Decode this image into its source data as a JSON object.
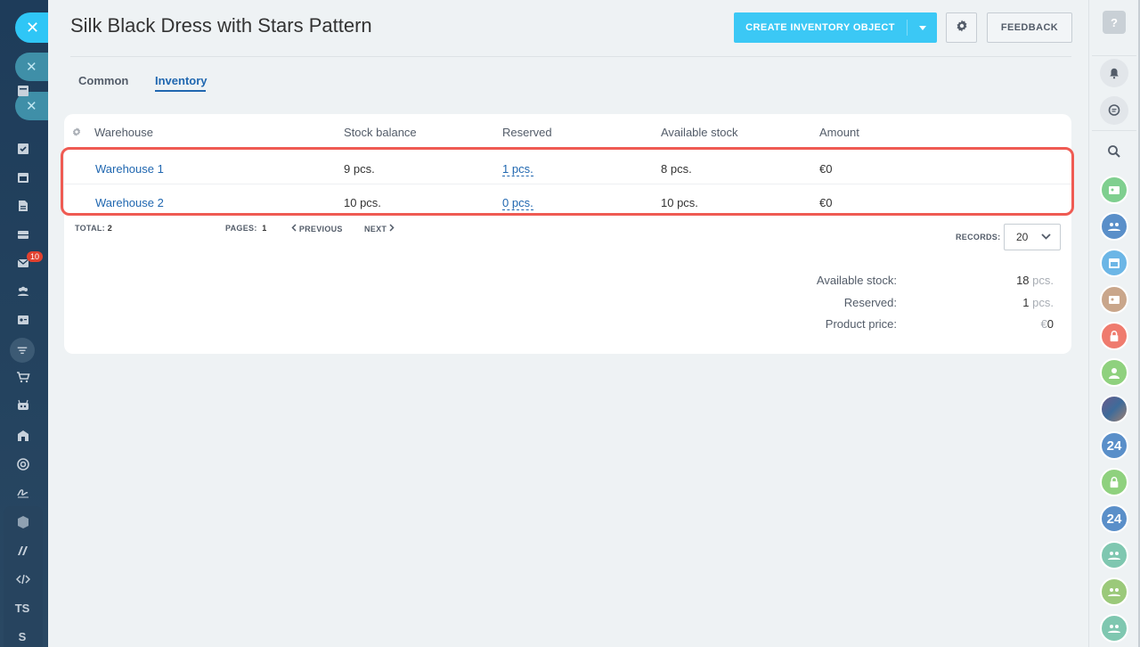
{
  "header": {
    "title": "Silk Black Dress with Stars Pattern",
    "create_button": "CREATE INVENTORY OBJECT",
    "feedback_button": "FEEDBACK"
  },
  "tabs": [
    {
      "label": "Common",
      "active": false
    },
    {
      "label": "Inventory",
      "active": true
    }
  ],
  "table": {
    "columns": [
      "Warehouse",
      "Stock balance",
      "Reserved",
      "Available stock",
      "Amount"
    ],
    "rows": [
      {
        "warehouse": "Warehouse 1",
        "stock_balance": "9 pcs.",
        "reserved": "1 pcs.",
        "available": "8 pcs.",
        "amount": "€0"
      },
      {
        "warehouse": "Warehouse 2",
        "stock_balance": "10 pcs.",
        "reserved": "0 pcs.",
        "available": "10 pcs.",
        "amount": "€0"
      }
    ]
  },
  "pager": {
    "total_label": "TOTAL:",
    "total_value": "2",
    "pages_label": "PAGES:",
    "pages_value": "1",
    "previous": "PREVIOUS",
    "next": "NEXT",
    "records_label": "RECORDS:",
    "records_value": "20"
  },
  "summary": {
    "available_label": "Available stock:",
    "available_value": "18",
    "available_unit": "pcs.",
    "reserved_label": "Reserved:",
    "reserved_value": "1",
    "reserved_unit": "pcs.",
    "price_label": "Product price:",
    "price_currency": "€",
    "price_value": "0"
  },
  "left_sidebar": {
    "mail_badge": "10",
    "text_items": [
      "TS",
      "S"
    ]
  },
  "right_sidebar": {
    "help": "?",
    "avatar_labels": [
      "24",
      "24"
    ]
  },
  "colors": {
    "accent": "#3bc8f5",
    "link": "#2067b0",
    "highlight": "#ef5b53",
    "sidebar": "#1f3b57"
  }
}
